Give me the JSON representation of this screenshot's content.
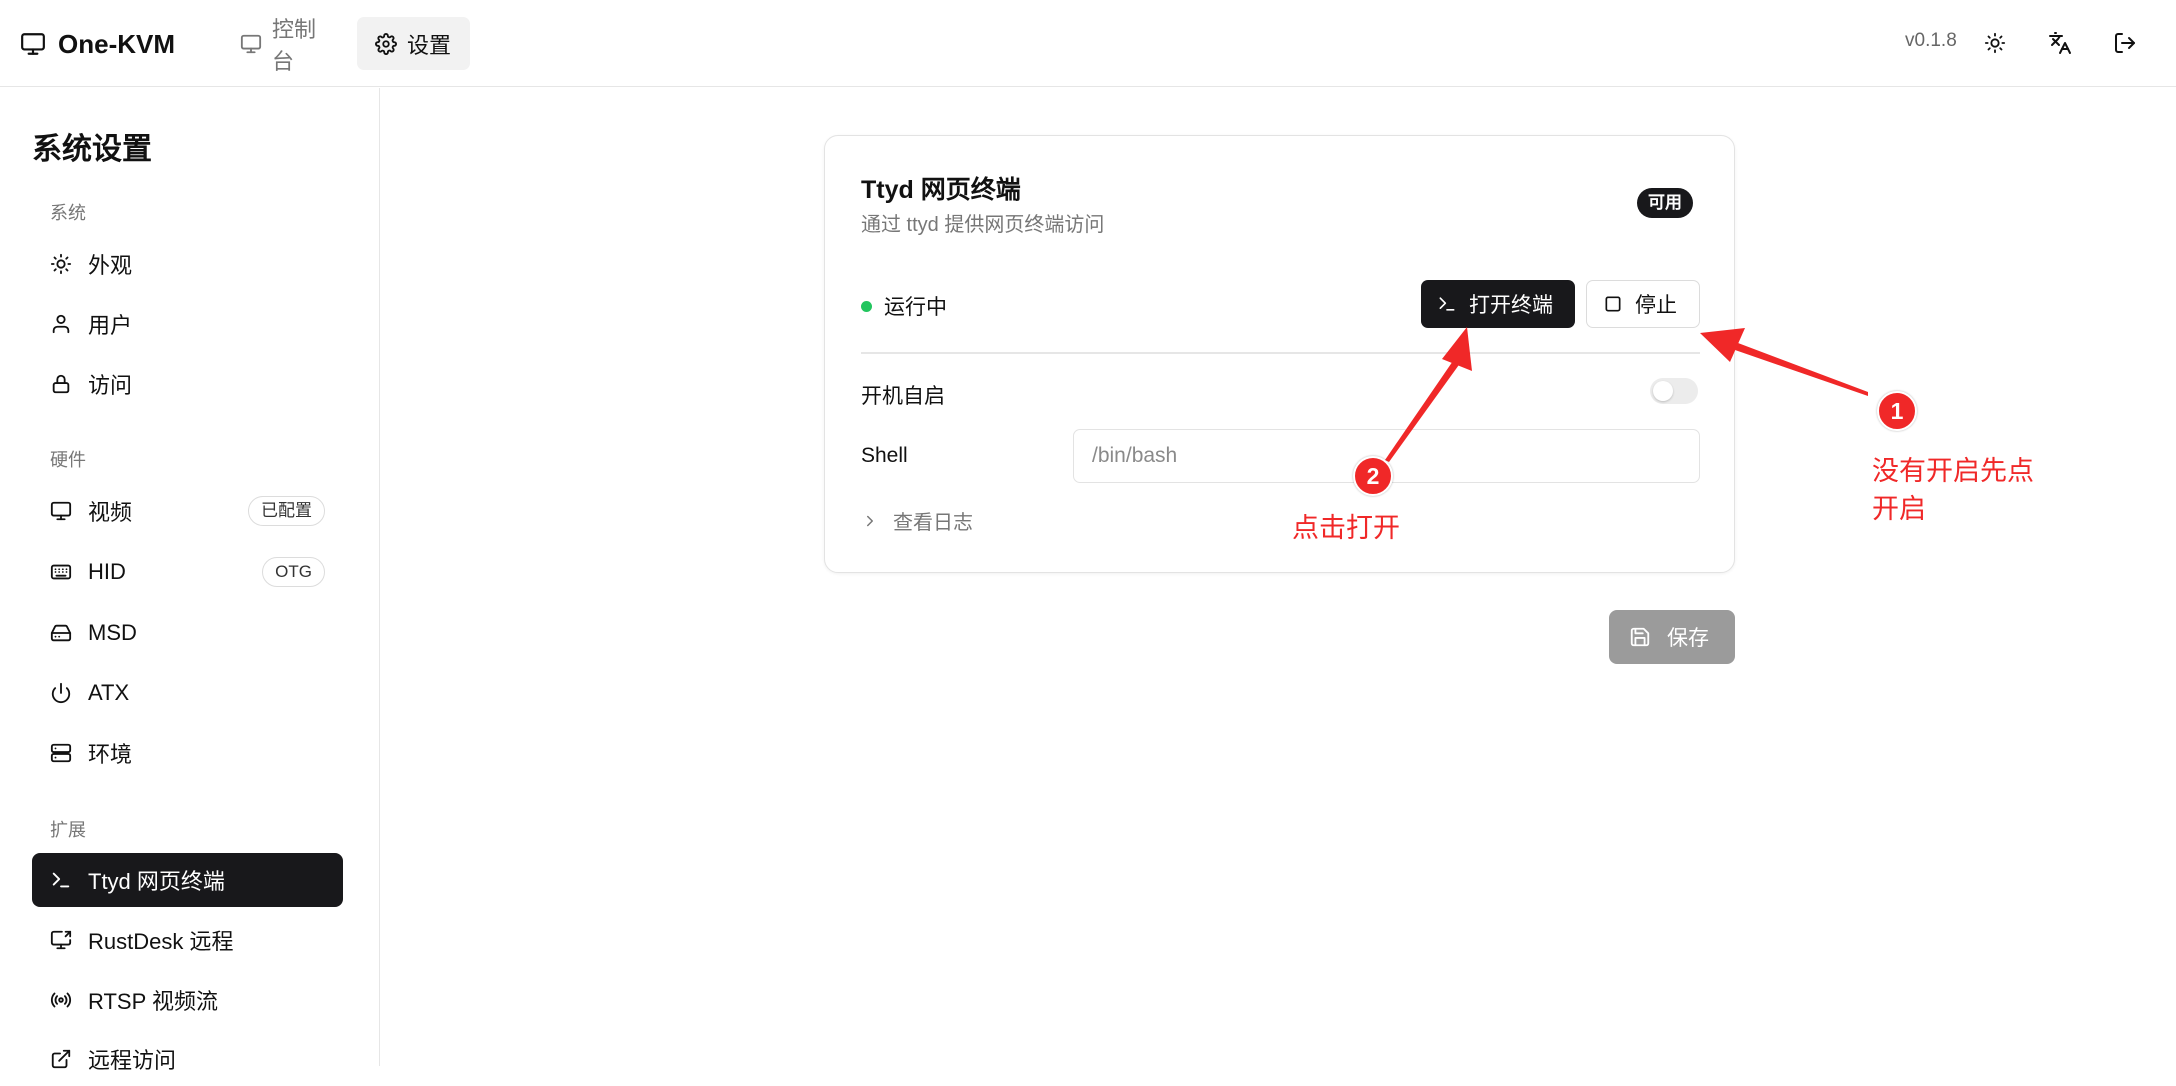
{
  "app": {
    "brand": "One-KVM",
    "version": "v0.1.8"
  },
  "topnav": {
    "console_label": "控制台",
    "settings_label": "设置"
  },
  "sidebar": {
    "title": "系统设置",
    "sections": {
      "system": "系统",
      "hardware": "硬件",
      "extensions": "扩展"
    },
    "items": [
      {
        "label": "外观",
        "icon": "sun-icon"
      },
      {
        "label": "用户",
        "icon": "user-icon"
      },
      {
        "label": "访问",
        "icon": "lock-icon"
      },
      {
        "label": "视频",
        "icon": "monitor-icon",
        "badge": "已配置"
      },
      {
        "label": "HID",
        "icon": "keyboard-icon",
        "badge": "OTG"
      },
      {
        "label": "MSD",
        "icon": "hard-drive-icon"
      },
      {
        "label": "ATX",
        "icon": "power-icon"
      },
      {
        "label": "环境",
        "icon": "server-icon"
      },
      {
        "label": "Ttyd 网页终端",
        "icon": "terminal-icon",
        "active": true
      },
      {
        "label": "RustDesk 远程",
        "icon": "screen-share-icon"
      },
      {
        "label": "RTSP 视频流",
        "icon": "radio-icon"
      },
      {
        "label": "远程访问",
        "icon": "external-link-icon"
      }
    ]
  },
  "card": {
    "title": "Ttyd 网页终端",
    "description": "通过 ttyd 提供网页终端访问",
    "badge": "可用",
    "status": "运行中",
    "open_button": "打开终端",
    "stop_button": "停止",
    "autostart_label": "开机自启",
    "autostart_enabled": false,
    "shell_label": "Shell",
    "shell_placeholder": "/bin/bash",
    "logs_label": "查看日志"
  },
  "save_button": "保存",
  "annotations": {
    "marker_1": "1",
    "marker_2": "2",
    "note_1_line1": "没有开启先点",
    "note_1_line2": "开启",
    "note_2": "点击打开"
  },
  "colors": {
    "accent_dark": "#18181b",
    "status_green": "#22c55e",
    "annotation_red": "#f02828",
    "save_disabled": "#9b9b9b"
  }
}
